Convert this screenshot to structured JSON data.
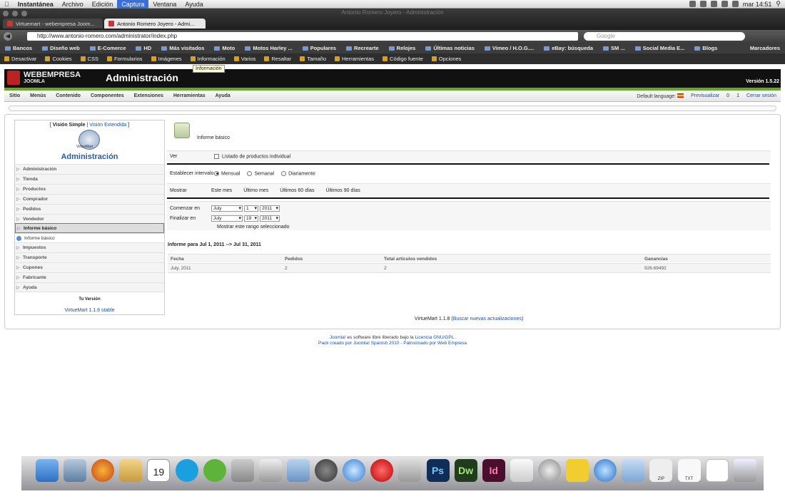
{
  "menubar": {
    "apple": "",
    "items": [
      "Instantánea",
      "Archivo",
      "Edición",
      "Captura",
      "Ventana",
      "Ayuda"
    ],
    "active_index": 3,
    "clock": "mar 14:51"
  },
  "browser": {
    "window_title": "Antonio Romero Joyero - Administración",
    "tabs": [
      "Virtuemart - webempresa Joom...",
      "Antonio Romero Joyero - Admi..."
    ],
    "url": "http://www.antonio-romero.com/administrator/index.php",
    "search_placeholder": "Google",
    "bookmarks": [
      "Bancos",
      "Diseño web",
      "E-Comerce",
      "HD",
      "Más visitados",
      "Moto",
      "Motos Harley ...",
      "Populares",
      "Recrearte",
      "Relojes",
      "Últimas noticias",
      "Vimeo / H.O.G....",
      "eBay: búsqueda",
      "SM ...",
      "Social Media E...",
      "Blogs"
    ],
    "bookmarks_right": "Marcadores",
    "webdev": [
      "Desactivar",
      "Cookies",
      "CSS",
      "Formularios",
      "Imágenes",
      "Información",
      "Varios",
      "Resaltar",
      "Tamaño",
      "Herramientas",
      "Código fuente",
      "Opciones"
    ],
    "tooltip": "Información"
  },
  "joomla": {
    "brand": "WEBEMPRESA",
    "brand_sub": "JOOMLA",
    "title": "Administración",
    "version": "Versión 1.5.22",
    "menu": [
      "Sitio",
      "Menús",
      "Contenido",
      "Componentes",
      "Extensiones",
      "Herramientas",
      "Ayuda"
    ],
    "default_language": "Default language:",
    "preview": "Previsualizar",
    "count_a": "0",
    "count_b": "1",
    "logout": "Cerrar sesión"
  },
  "sidebar": {
    "view_simple": "Visión Simple",
    "view_extended": "Visión Extendida",
    "logo_text": "VirtueMart",
    "admin_title": "Administración",
    "items": [
      "Administración",
      "Tienda",
      "Productos",
      "Comprador",
      "Pedidos",
      "Vendedor",
      "Informe básico",
      "Informe básico",
      "Impuestos",
      "Transporte",
      "Cupones",
      "Fabricante",
      "Ayuda"
    ],
    "your_version": "Tu Versión",
    "version_link": "VirtueMart 1.1.8 stable"
  },
  "report": {
    "title": "Informe básico",
    "ver_label": "Ver",
    "individual_list": "Listado de productos individual",
    "interval_label": "Establecer intervalo",
    "interval_options": [
      "Mensual",
      "Semanal",
      "Diariamente"
    ],
    "interval_selected": "Mensual",
    "show_label": "Mostrar",
    "show_options": [
      "Este mes",
      "Último mes",
      "Últimos 60 días",
      "Últimos 90 días"
    ],
    "start_label": "Comenzar en",
    "start": {
      "month": "July",
      "day": "1",
      "year": "2011"
    },
    "end_label": "Finalizar en",
    "end": {
      "month": "July",
      "day": "19",
      "year": "2011"
    },
    "show_range_button": "Mostrar este rango seleccionado",
    "result_title": "Informe para Jul 1, 2011 --> Jul 31, 2011",
    "columns": [
      "Fecha",
      "Pedidos",
      "Total artículos vendidos",
      "Ganancias"
    ],
    "rows": [
      [
        "July, 2011",
        "2",
        "2",
        "926.69492"
      ]
    ],
    "footer_text": "VirtueMart 1.1.8",
    "footer_link": "Buscar nuevas actualizaciones"
  },
  "footer": {
    "joomla_link": "Joomla!",
    "line1_mid": " es software libre liberado bajo la ",
    "license_link": "Licencia GNU/GPL.",
    "line2": "Pack creado por Joomla! Spanish 2010 - Patrocinado por Web Empresa"
  },
  "dock": {
    "icons": [
      "finder-icon",
      "preview-icon",
      "firefox-icon",
      "mail-icon",
      "ical-icon",
      "skype-icon",
      "spotify-icon",
      "iphoto-icon",
      "ilife-icon",
      "folder-icon",
      "x-icon",
      "safari-icon",
      "opera-icon",
      "scissors-icon",
      "photoshop-icon",
      "dreamweaver-icon",
      "indesign-icon",
      "paper-icon",
      "utility-icon",
      "bird-icon",
      "itunes-icon",
      "folder-blue-icon",
      "zip-icon",
      "txt-icon",
      "document-icon",
      "trash-icon"
    ],
    "calendar_day": "19",
    "ps_label": "Ps",
    "dw_label": "Dw",
    "id_label": "Id",
    "zip_label": "ZIP",
    "txt_label": "TXT"
  }
}
